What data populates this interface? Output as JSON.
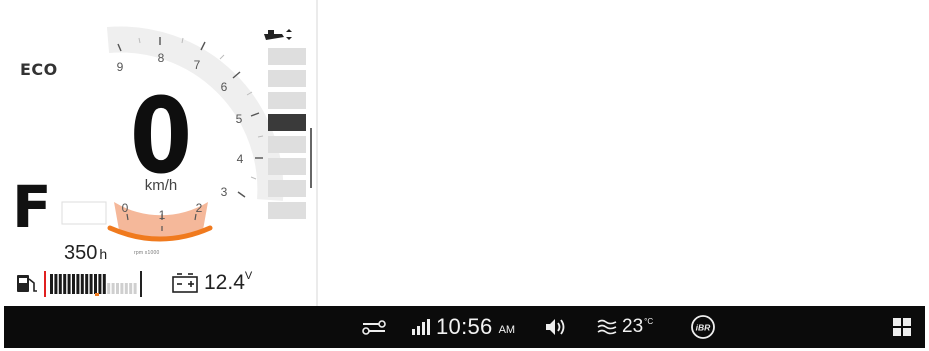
{
  "dashboard": {
    "mode": "ECO",
    "speed": "0",
    "speed_unit": "km/h",
    "gear": "F",
    "engine_hours": "350",
    "engine_hours_unit": "h",
    "rpm_ticks_outer": [
      "9",
      "8",
      "7",
      "6",
      "5",
      "4",
      "3"
    ],
    "rpm_ticks_inner": [
      "0",
      "1",
      "2"
    ],
    "rpm_caption": "rpm x1000",
    "fuel_level_fraction": 0.65,
    "battery_voltage": "12.4",
    "battery_voltage_unit": "V",
    "trim_segments": 8,
    "trim_active_segment": 5
  },
  "status_bar": {
    "time": "10:56",
    "ampm": "AM",
    "water_temp": "23",
    "water_temp_unit": "°C",
    "ibr_label": "iBR"
  },
  "colors": {
    "accent_orange": "#f07a1e",
    "rpm_fill": "#f5b89a",
    "status_bar_bg": "#0b0b0b"
  },
  "icons": [
    "trim-icon",
    "fuel-icon",
    "battery-icon",
    "traction-icon",
    "signal-icon",
    "volume-icon",
    "water-temp-icon",
    "ibr-icon",
    "apps-grid-icon"
  ]
}
